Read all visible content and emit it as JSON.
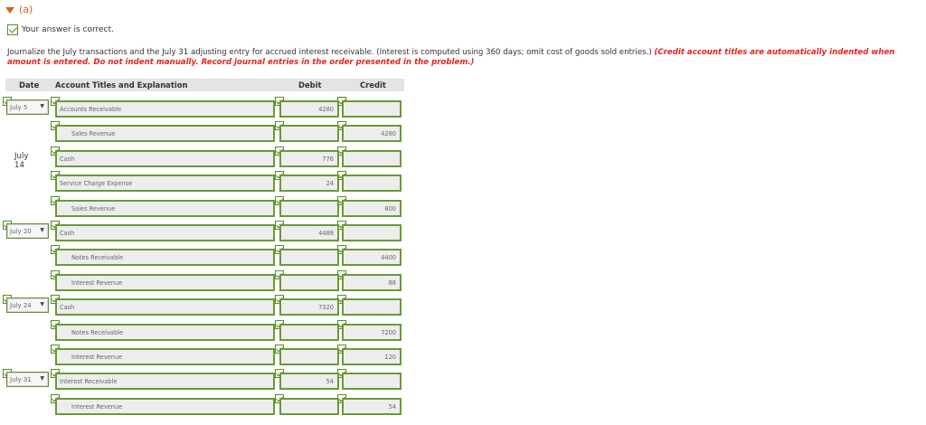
{
  "part_label": "(a)",
  "status_text": "Your answer is correct.",
  "instructions": {
    "text": "Journalize the July transactions and the July 31 adjusting entry for accrued interest receivable. (Interest is computed using 360 days; omit cost of goods sold entries.)",
    "note": "(Credit account titles are automatically indented when amount is entered. Do not indent manually. Record journal entries in the order presented in the problem.)"
  },
  "table": {
    "headers": {
      "date": "Date",
      "account": "Account Titles and Explanation",
      "debit": "Debit",
      "credit": "Credit"
    }
  },
  "rows": [
    {
      "date": "July 5",
      "date_select": true,
      "account": "Accounts Receivable",
      "indent": false,
      "debit": "4280",
      "credit": ""
    },
    {
      "date": "",
      "date_select": false,
      "account": "Sales Revenue",
      "indent": true,
      "debit": "",
      "credit": "4280"
    },
    {
      "date": "July 14",
      "date_select": false,
      "account": "Cash",
      "indent": false,
      "debit": "776",
      "credit": ""
    },
    {
      "date": "",
      "date_select": false,
      "account": "Service Charge Expense",
      "indent": false,
      "debit": "24",
      "credit": ""
    },
    {
      "date": "",
      "date_select": false,
      "account": "Sales Revenue",
      "indent": true,
      "debit": "",
      "credit": "800"
    },
    {
      "date": "July 20",
      "date_select": true,
      "account": "Cash",
      "indent": false,
      "debit": "4488",
      "credit": ""
    },
    {
      "date": "",
      "date_select": false,
      "account": "Notes Receivable",
      "indent": true,
      "debit": "",
      "credit": "4400"
    },
    {
      "date": "",
      "date_select": false,
      "account": "Interest Revenue",
      "indent": true,
      "debit": "",
      "credit": "88"
    },
    {
      "date": "July 24",
      "date_select": true,
      "account": "Cash",
      "indent": false,
      "debit": "7320",
      "credit": ""
    },
    {
      "date": "",
      "date_select": false,
      "account": "Notes Receivable",
      "indent": true,
      "debit": "",
      "credit": "7200"
    },
    {
      "date": "",
      "date_select": false,
      "account": "Interest Revenue",
      "indent": true,
      "debit": "",
      "credit": "120"
    },
    {
      "date": "July 31",
      "date_select": true,
      "account": "Interest Receivable",
      "indent": false,
      "debit": "54",
      "credit": ""
    },
    {
      "date": "",
      "date_select": false,
      "account": "Interest Revenue",
      "indent": true,
      "debit": "",
      "credit": "54"
    }
  ],
  "colors": {
    "accent": "#d9621a",
    "correct_border": "#6a9a34",
    "note_red": "#e8231c"
  }
}
